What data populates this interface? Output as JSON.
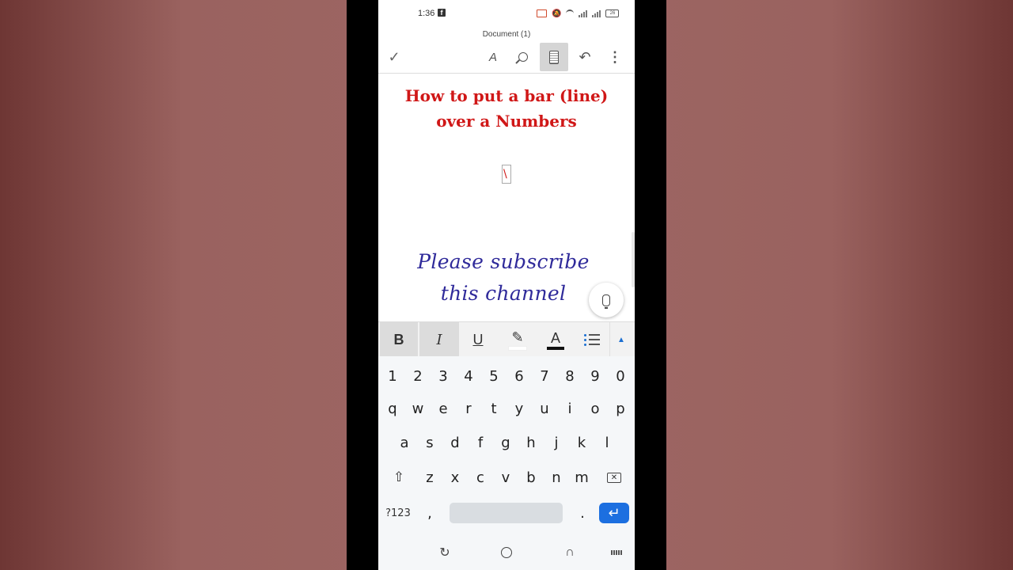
{
  "status_bar": {
    "time": "1:36",
    "fb_badge": "f",
    "battery": "26"
  },
  "doc_title": "Document (1)",
  "toolbar": {
    "check_glyph": "✓",
    "draw_glyph": "A",
    "undo_glyph": "↶",
    "more_glyph": "⋮"
  },
  "document": {
    "heading_line1": "How to put a bar (line)",
    "heading_line2": "over a Numbers",
    "equation_mark": "\\",
    "subscribe_line1": "Please subscribe",
    "subscribe_line2": "this channel"
  },
  "format_bar": {
    "bold": "B",
    "italic": "I",
    "underline": "U",
    "font_color": "A",
    "highlight_glyph": "✎",
    "collapse_glyph": "▲",
    "highlight_color": "#ffffff",
    "font_color_value": "#111111"
  },
  "keyboard": {
    "numbers": [
      "1",
      "2",
      "3",
      "4",
      "5",
      "6",
      "7",
      "8",
      "9",
      "0"
    ],
    "row1": [
      "q",
      "w",
      "e",
      "r",
      "t",
      "y",
      "u",
      "i",
      "o",
      "p"
    ],
    "row2": [
      "a",
      "s",
      "d",
      "f",
      "g",
      "h",
      "j",
      "k",
      "l"
    ],
    "row3": [
      "z",
      "x",
      "c",
      "v",
      "b",
      "n",
      "m"
    ],
    "shift_glyph": "⇧",
    "backspace_glyph": "✕",
    "sym_label": "?123",
    "comma": ",",
    "period": ".",
    "enter_glyph": "↵"
  },
  "nav_bar": {
    "recent_glyph": "↻",
    "back_glyph": "∩"
  },
  "colors": {
    "heading": "#d01717",
    "subscribe": "#2f2a9a",
    "accent": "#1c6fe0"
  }
}
